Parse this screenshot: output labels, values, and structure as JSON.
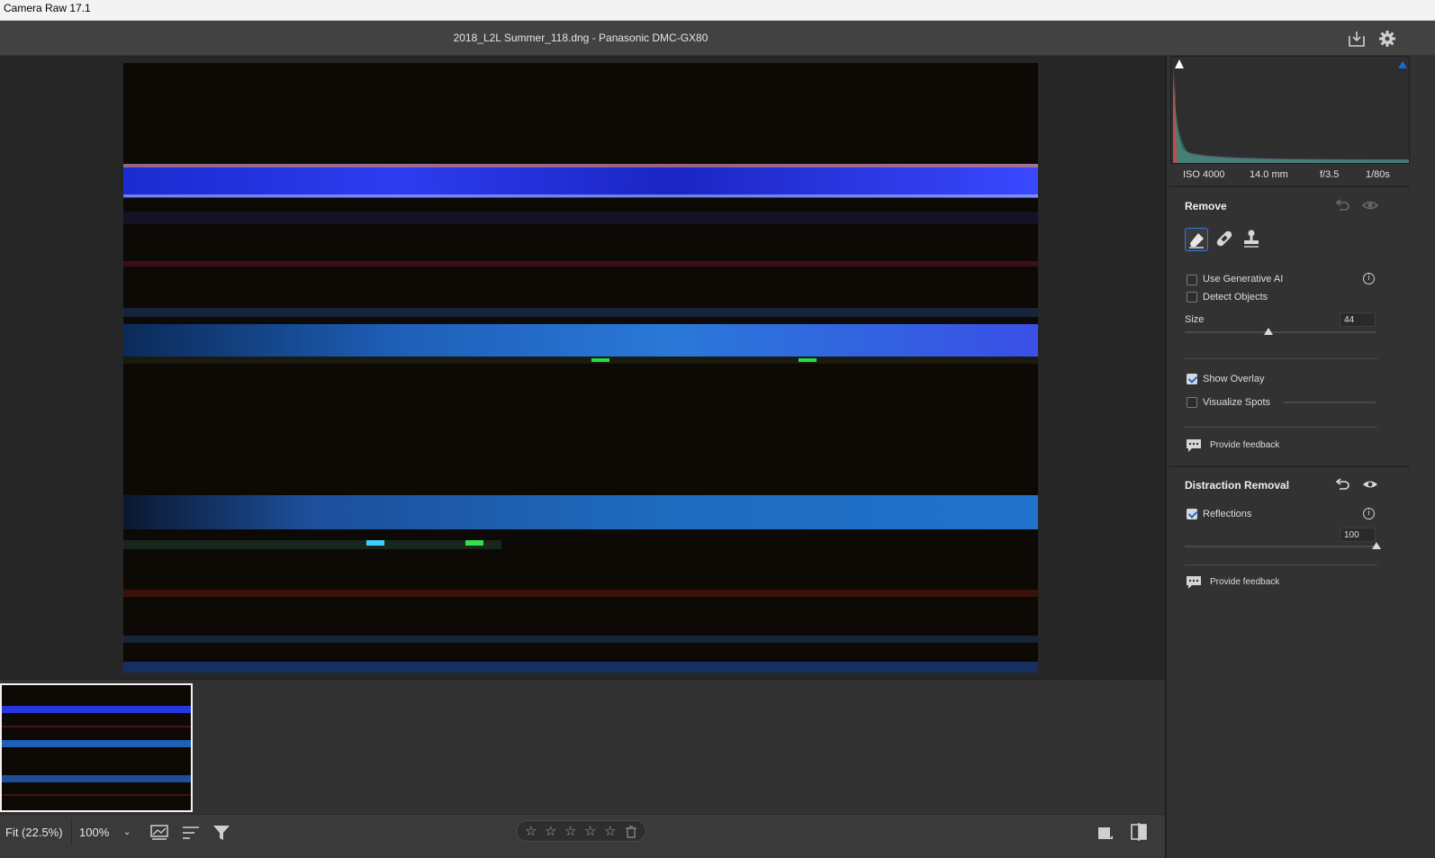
{
  "window": {
    "title": "Camera Raw 17.1"
  },
  "header": {
    "file_info": "2018_L2L Summer_118.dng  -  Panasonic DMC-GX80",
    "icons": [
      "save-icon",
      "gear-icon"
    ]
  },
  "histogram": {
    "iso": "ISO 4000",
    "focal": "14.0 mm",
    "aperture": "f/3.5",
    "shutter": "1/80s"
  },
  "remove": {
    "title": "Remove",
    "tools": [
      "eraser-icon",
      "healing-icon",
      "stamp-icon"
    ],
    "use_gen_ai": {
      "label": "Use Generative AI",
      "checked": false
    },
    "detect_objects": {
      "label": "Detect Objects",
      "checked": false
    },
    "size": {
      "label": "Size",
      "value": "44"
    },
    "show_overlay": {
      "label": "Show Overlay",
      "checked": true
    },
    "visualize_spots": {
      "label": "Visualize Spots",
      "checked": false
    },
    "feedback": "Provide feedback"
  },
  "distraction": {
    "title": "Distraction Removal",
    "reflections": {
      "label": "Reflections",
      "checked": true
    },
    "amount": "100",
    "feedback": "Provide feedback"
  },
  "bottom": {
    "fit": "Fit (22.5%)",
    "zoom": "100%",
    "rating": 0
  },
  "colors": {
    "accent": "#1a6bd1",
    "panel": "#323232",
    "canvas": "#262626"
  }
}
